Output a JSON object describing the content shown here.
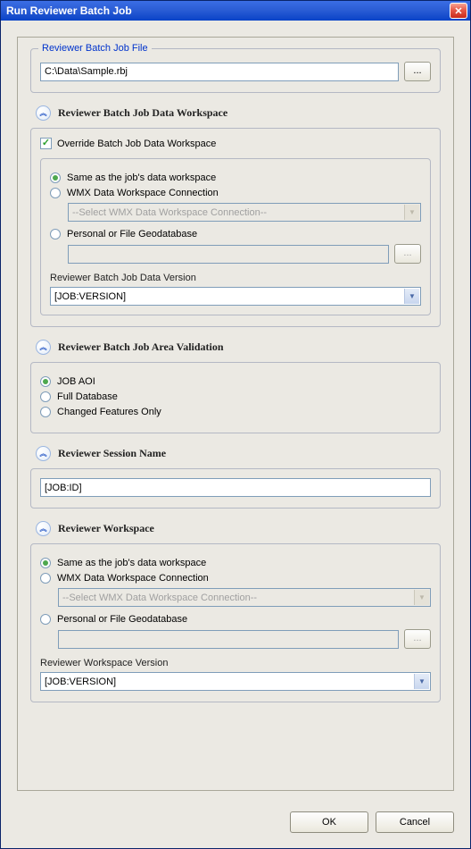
{
  "window": {
    "title": "Run Reviewer Batch Job",
    "close": "✕"
  },
  "batch_file": {
    "legend": "Reviewer Batch Job File",
    "path": "C:\\Data\\Sample.rbj",
    "browse": "..."
  },
  "data_workspace": {
    "title": "Reviewer Batch Job Data Workspace",
    "override_label": "Override Batch Job Data Workspace",
    "override_checked": true,
    "opt_same": "Same as the job's data workspace",
    "opt_wmx": "WMX Data Workspace Connection",
    "wmx_placeholder": "--Select WMX Data Workspace Connection--",
    "opt_personal": "Personal or File Geodatabase",
    "browse": "...",
    "version_label": "Reviewer Batch Job Data Version",
    "version_value": "[JOB:VERSION]"
  },
  "area_validation": {
    "title": "Reviewer Batch Job Area Validation",
    "opt_job_aoi": "JOB AOI",
    "opt_full_db": "Full Database",
    "opt_changed": "Changed Features Only"
  },
  "session_name": {
    "title": "Reviewer Session Name",
    "value": "[JOB:ID]"
  },
  "reviewer_workspace": {
    "title": "Reviewer Workspace",
    "opt_same": "Same as the job's data workspace",
    "opt_wmx": "WMX Data Workspace Connection",
    "wmx_placeholder": "--Select WMX Data Workspace Connection--",
    "opt_personal": "Personal or File Geodatabase",
    "browse": "...",
    "version_label": "Reviewer Workspace Version",
    "version_value": "[JOB:VERSION]"
  },
  "footer": {
    "ok": "OK",
    "cancel": "Cancel"
  },
  "icons": {
    "chevrons": "︽",
    "dropdown": "▼"
  }
}
